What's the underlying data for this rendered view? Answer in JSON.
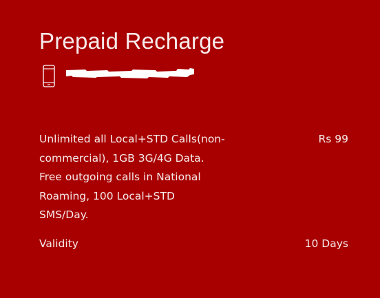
{
  "card": {
    "title": "Prepaid Recharge",
    "phone_icon": "mobile-phone-icon",
    "phone_number_redacted": true,
    "background_color": "#a80000",
    "text_color": "#f7eaea"
  },
  "plan": {
    "description": "Unlimited all Local+STD Calls(non-commercial), 1GB 3G/4G Data. Free outgoing calls in National Roaming, 100 Local+STD SMS/Day.",
    "price": "Rs 99",
    "validity_label": "Validity",
    "validity_value": "10 Days"
  }
}
